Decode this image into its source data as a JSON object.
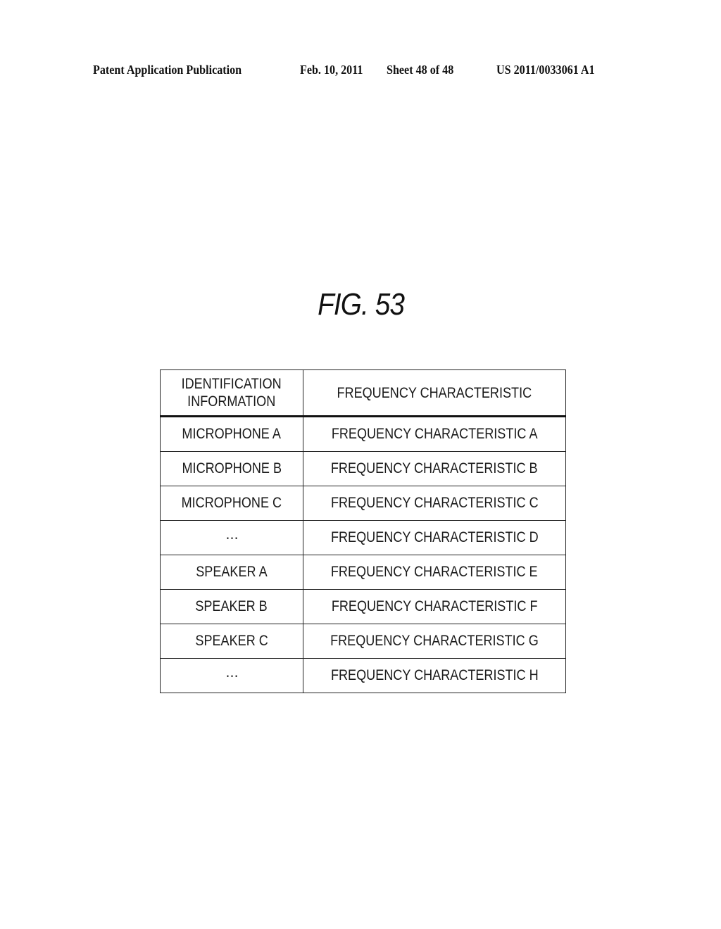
{
  "header": {
    "publication_label": "Patent Application Publication",
    "date": "Feb. 10, 2011",
    "sheet": "Sheet 48 of 48",
    "patent_number": "US 2011/0033061 A1"
  },
  "figure": {
    "title": "FIG. 53"
  },
  "table": {
    "columns": [
      "IDENTIFICATION INFORMATION",
      "FREQUENCY CHARACTERISTIC"
    ],
    "column_lines": [
      [
        "IDENTIFICATION",
        "INFORMATION"
      ],
      [
        "FREQUENCY CHARACTERISTIC"
      ]
    ],
    "rows": [
      {
        "identification": "MICROPHONE A",
        "frequency": "FREQUENCY CHARACTERISTIC A"
      },
      {
        "identification": "MICROPHONE B",
        "frequency": "FREQUENCY CHARACTERISTIC B"
      },
      {
        "identification": "MICROPHONE C",
        "frequency": "FREQUENCY CHARACTERISTIC C"
      },
      {
        "identification": "⋯",
        "frequency": "FREQUENCY CHARACTERISTIC D"
      },
      {
        "identification": "SPEAKER A",
        "frequency": "FREQUENCY CHARACTERISTIC E"
      },
      {
        "identification": "SPEAKER B",
        "frequency": "FREQUENCY CHARACTERISTIC F"
      },
      {
        "identification": "SPEAKER C",
        "frequency": "FREQUENCY CHARACTERISTIC G"
      },
      {
        "identification": "⋯",
        "frequency": "FREQUENCY CHARACTERISTIC H"
      }
    ]
  }
}
